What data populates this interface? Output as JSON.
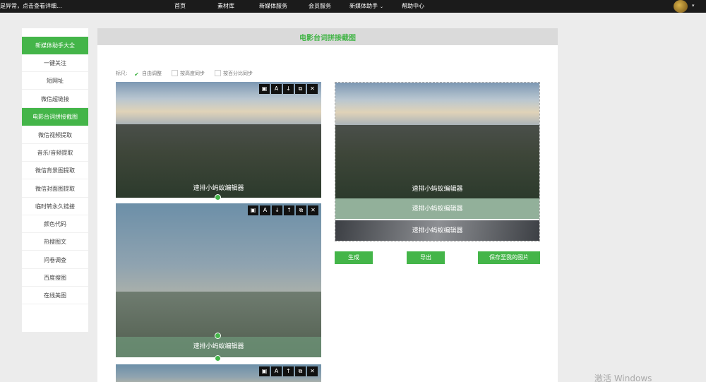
{
  "topbar": {
    "notice": "是异常，点击查看详细...",
    "nav": [
      "首页",
      "素材库",
      "新媒体服务",
      "会员服务",
      "新媒体助手",
      "帮助中心"
    ]
  },
  "sidebar": {
    "items": [
      "新媒体助手大全",
      "一键关注",
      "短网址",
      "微信超链接",
      "电影台词拼接截图",
      "微信视频提取",
      "音乐/音频提取",
      "微信背景图提取",
      "微信封面图提取",
      "临时转永久链接",
      "颜色代码",
      "热搜图文",
      "问卷调查",
      "百度搜图",
      "在线美图"
    ],
    "active": [
      0,
      4
    ]
  },
  "panel": {
    "title": "电影台词拼接截图",
    "options": {
      "label": "标尺:",
      "free": "自由调整",
      "height_sync": "按高度同步",
      "percent_sync": "按百分比同步",
      "checked": "free"
    }
  },
  "caption": "速排小蚂蚁编辑器",
  "toolbar_icons": [
    "image-icon",
    "text-icon",
    "arrow-down-icon",
    "arrow-up-icon",
    "copy-icon",
    "close-icon"
  ],
  "toolbar_glyphs": {
    "image": "▣",
    "text": "A",
    "down": "↓",
    "up": "↑",
    "copy": "⧉",
    "close": "✕"
  },
  "buttons": {
    "generate": "生成",
    "export": "导出",
    "save": "保存至我的图片"
  },
  "watermark": "激活 Windows",
  "colors": {
    "accent": "#44b549",
    "topbar": "#1b1b1b"
  }
}
